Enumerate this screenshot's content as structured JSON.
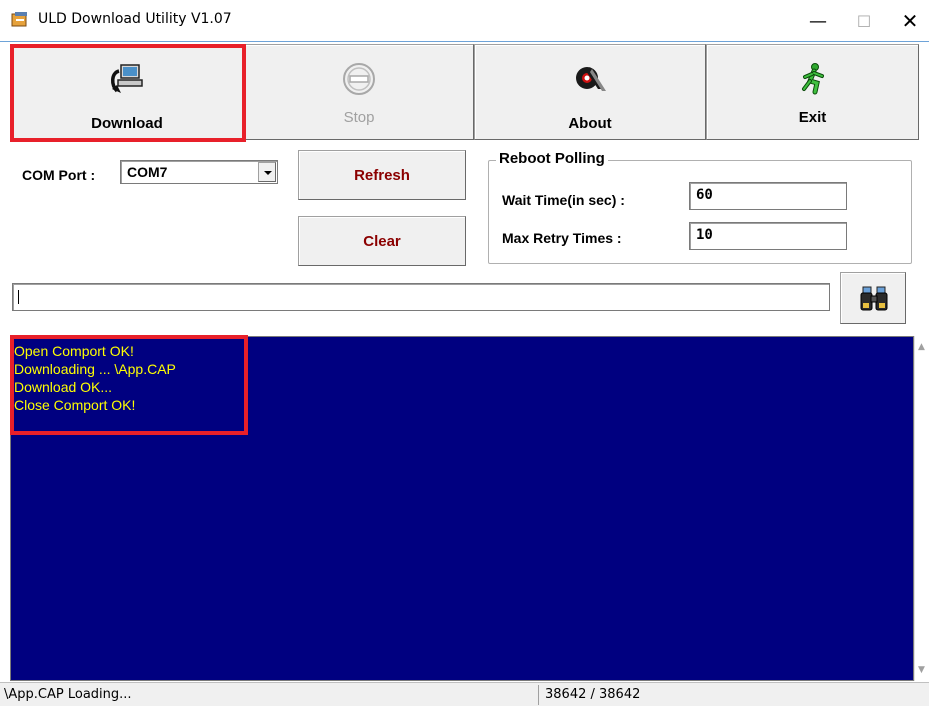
{
  "window": {
    "title": "ULD Download Utility  V1.07",
    "controls": {
      "minimize": "—",
      "maximize": "☐",
      "close": "✕"
    }
  },
  "toolbar": {
    "download_label": "Download",
    "stop_label": "Stop",
    "about_label": "About",
    "exit_label": "Exit",
    "icons": {
      "download": "computer-download-icon",
      "stop": "stop-icon",
      "about": "company-logo-icon",
      "exit": "running-man-icon"
    }
  },
  "settings": {
    "com_port_label": "COM Port :",
    "com_port_value": "COM7",
    "refresh_label": "Refresh",
    "clear_label": "Clear",
    "reboot_group_title": "Reboot Polling",
    "wait_time_label": "Wait Time(in sec) :",
    "wait_time_value": "60",
    "max_retry_label": "Max Retry Times :",
    "max_retry_value": "10"
  },
  "path": {
    "value": "",
    "browse_icon": "binoculars-icon"
  },
  "log": {
    "lines": [
      "Open Comport OK!",
      "Downloading ... \\App.CAP",
      "Download OK...",
      "Close Comport OK!"
    ]
  },
  "status": {
    "left": "\\App.CAP Loading...",
    "right": "38642 / 38642"
  },
  "colors": {
    "log_background": "#000080",
    "log_text": "#ffff00",
    "highlight": "#e8202a",
    "button_text_dark_red": "#8b0000"
  }
}
